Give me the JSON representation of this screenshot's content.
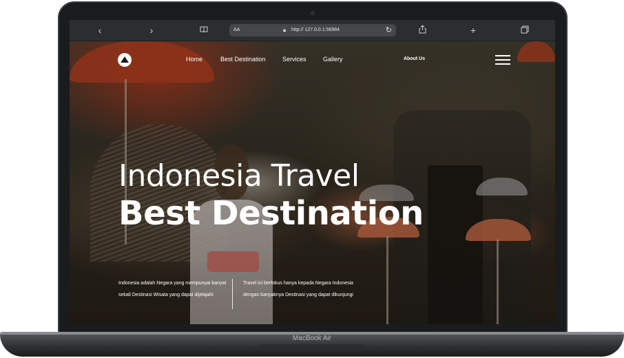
{
  "device": {
    "model_label": "MacBook Air"
  },
  "browser": {
    "back_icon": "chevron-left-icon",
    "forward_icon": "chevron-right-icon",
    "reader_label": "AA",
    "url": "http:// 127.0.0.1:56984",
    "icons": [
      "book-icon",
      "lock-icon",
      "reload-icon",
      "share-icon",
      "plus-icon",
      "tabs-icon"
    ]
  },
  "nav": {
    "items": [
      {
        "label": "Home"
      },
      {
        "label": "Best Destination"
      },
      {
        "label": "Services"
      },
      {
        "label": "Gallery"
      }
    ],
    "about_label": "About Us",
    "menu_icon": "hamburger-menu-icon",
    "logo_icon": "mountain-logo-icon"
  },
  "hero": {
    "title_line1": "Indonesia Travel",
    "title_line2": "Best Destination",
    "desc_left": "Indonesia adalah Negara yang mempunyai banyat sekali Destinasi Wisata yang dapat dijelajahi",
    "desc_right": "Travel ini berfokus hanya kepada Negara Indonesia dengan banyaknya Destinasi yang dapat dikunjungi"
  },
  "colors": {
    "frame": "#1a1b1d",
    "browser_bar": "#2c2d30",
    "url_bar": "#46474b",
    "text_on_hero": "#ffffff"
  }
}
